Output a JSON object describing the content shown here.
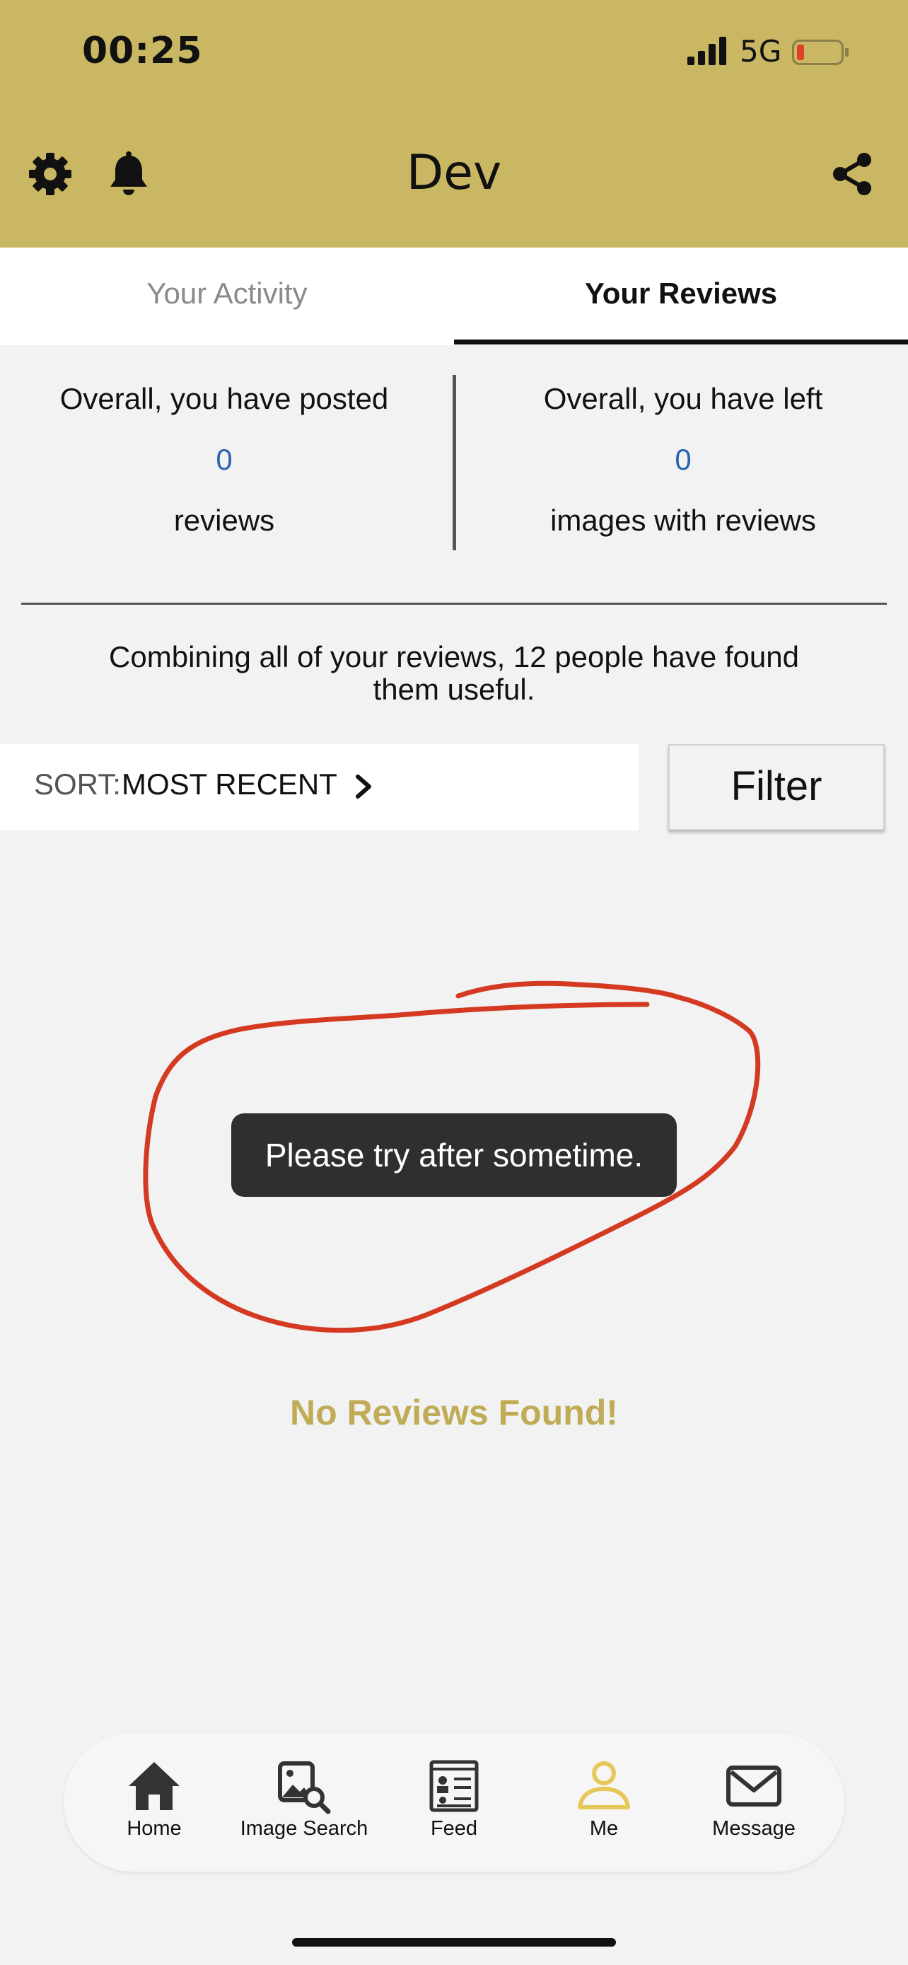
{
  "status_bar": {
    "time": "00:25",
    "network": "5G"
  },
  "header": {
    "title": "Dev"
  },
  "tabs": [
    {
      "label": "Your Activity"
    },
    {
      "label": "Your Reviews"
    }
  ],
  "stats": {
    "left": {
      "prefix": "Overall, you have posted",
      "count": "0",
      "suffix": "reviews"
    },
    "right": {
      "prefix": "Overall, you have left",
      "count": "0",
      "suffix": "images with reviews"
    }
  },
  "summary": {
    "line1": "Combining all of your reviews, 12 people have found",
    "line2": "them useful."
  },
  "sort": {
    "label": "SORT:",
    "value": "MOST RECENT"
  },
  "filter": {
    "label": "Filter"
  },
  "toast": {
    "message": "Please try after sometime."
  },
  "empty_state": {
    "message": "No Reviews Found!"
  },
  "bottom_nav": [
    {
      "label": "Home",
      "icon": "home-icon"
    },
    {
      "label": "Image Search",
      "icon": "image-search-icon"
    },
    {
      "label": "Feed",
      "icon": "feed-icon"
    },
    {
      "label": "Me",
      "icon": "person-icon",
      "active": true
    },
    {
      "label": "Message",
      "icon": "mail-icon"
    }
  ],
  "colors": {
    "header_bg": "#c9b763",
    "accent": "#c0ab56",
    "count_blue": "#2a64b0",
    "annotation_red": "#d43a22",
    "toast_bg": "#2f2f2f"
  }
}
